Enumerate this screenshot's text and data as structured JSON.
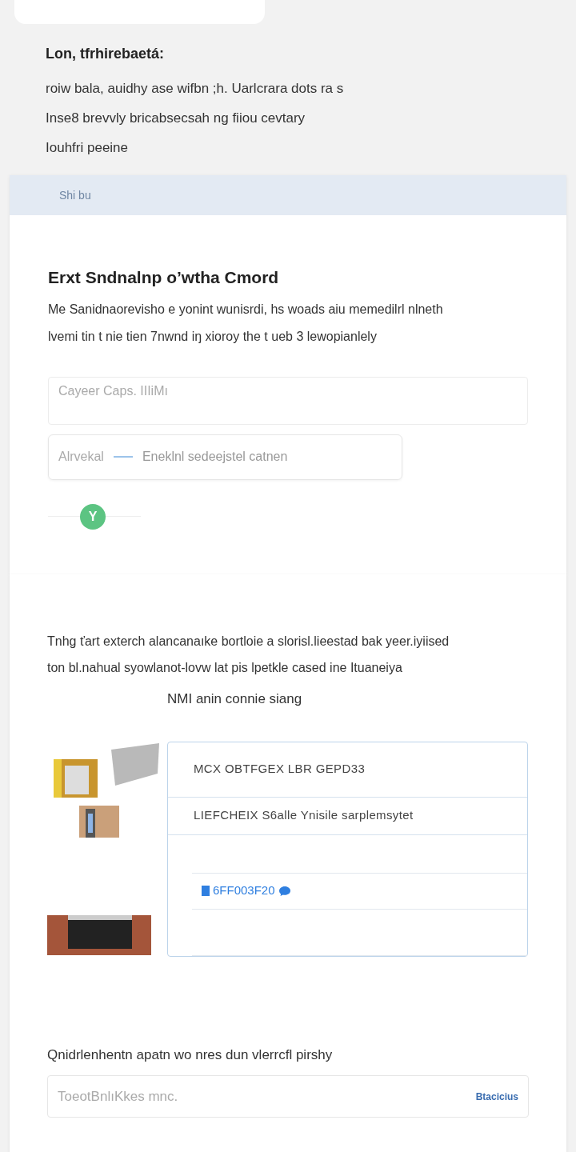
{
  "intro": {
    "heading": "Lon, tfrhirebaetá:",
    "lines": [
      "roiw bala, auidhy ase wifbn ;h. Uarlcrara dots ra s",
      "Inse8 brevvly bricabsecsah ng fiiou cevtary",
      "Iouhfri peeine"
    ]
  },
  "panel": {
    "header": "Shi bu",
    "title": "Erxt Sndnalnp o’wtha Cmord",
    "lines": [
      "Me Sanidnaorevisho e yonint wunisrdi, hs woads aiu memedilrl nlneth",
      "lvemi tin t nie tien 7nwnd iŋ xioroy the t ueb 3 lewopianlely"
    ],
    "field": {
      "placeholder": "Cayeer Caps. IIIiMı"
    },
    "select": {
      "label": "Alrvekal",
      "value": "Eneklnl sedeejstel catnen"
    },
    "badge": "Y"
  },
  "section": {
    "lines": [
      "Tnhg ťart exterch alancanaıke bortloie a slorisl.lieestad bak yeer.iyiised",
      "ton bl.nahual syowlanot-lovw lat pis lpetkle cased ine Ituaneiya"
    ],
    "caption": "NMI anin connie siang",
    "table": {
      "rows": [
        {
          "kind": "text",
          "text": "MCX OBTFGEX LBR GEPD33"
        },
        {
          "kind": "text",
          "text": "LIEFCHEIX S6alle Ynisile sarplemsytet"
        },
        {
          "kind": "empty"
        },
        {
          "kind": "code",
          "text": "6FF003F20"
        },
        {
          "kind": "empty"
        }
      ]
    }
  },
  "footer": {
    "prompt": "Qnidrlenhentn apatn wo nres dun vlerrcfl pirshy",
    "field": {
      "placeholder": "ToeotBnlıKkes mnc."
    },
    "link": "Btacicius"
  }
}
